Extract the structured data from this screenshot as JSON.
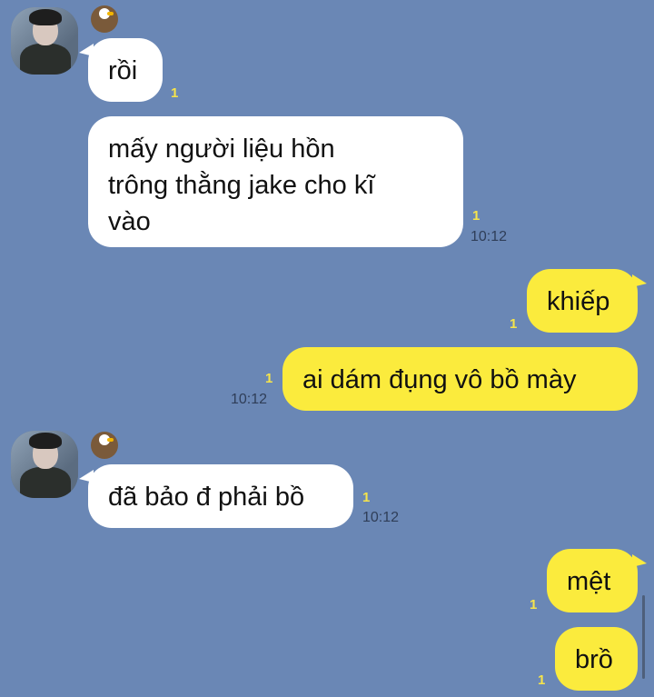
{
  "colors": {
    "background": "#6a87b5",
    "incoming_bubble": "#ffffff",
    "outgoing_bubble": "#fbeb3d",
    "unread_count": "#f6e44a",
    "timestamp": "#2f3e58"
  },
  "messages": [
    {
      "direction": "incoming",
      "text": "rồi",
      "unread": "1",
      "time": ""
    },
    {
      "direction": "incoming",
      "text": "mấy người liệu hồn\ntrông thằng jake cho kĩ\nvào",
      "unread": "1",
      "time": "10:12"
    },
    {
      "direction": "outgoing",
      "text": "khiếp",
      "unread": "1",
      "time": ""
    },
    {
      "direction": "outgoing",
      "text": "ai dám đụng vô bồ mày",
      "unread": "1",
      "time": "10:12"
    },
    {
      "direction": "incoming",
      "text": "đã bảo đ phải bồ",
      "unread": "1",
      "time": "10:12"
    },
    {
      "direction": "outgoing",
      "text": "mệt",
      "unread": "1",
      "time": ""
    },
    {
      "direction": "outgoing",
      "text": "brồ",
      "unread": "1",
      "time": ""
    }
  ],
  "icons": {
    "sender_avatar": "avatar-photo",
    "sender_badge": "eagle-icon"
  }
}
